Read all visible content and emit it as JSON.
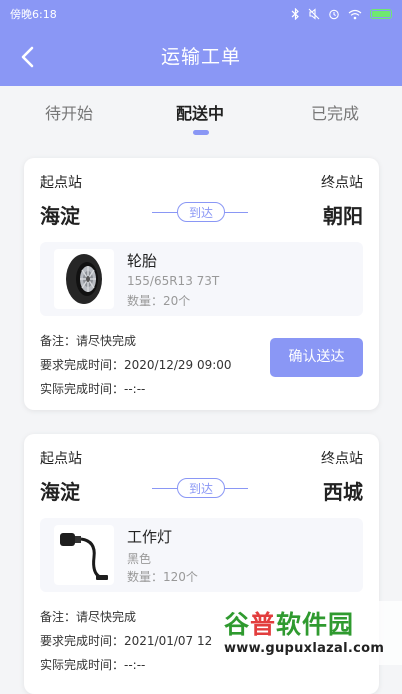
{
  "status_bar": {
    "time": "傍晚6:18",
    "icons": [
      "bluetooth-icon",
      "mute-icon",
      "alarm-icon",
      "wifi-icon",
      "battery-icon"
    ]
  },
  "header": {
    "title": "运输工单",
    "back_icon": "chevron-left-icon"
  },
  "tabs": [
    {
      "label": "待开始",
      "active": false
    },
    {
      "label": "配送中",
      "active": true
    },
    {
      "label": "已完成",
      "active": false
    }
  ],
  "orders": [
    {
      "start_label": "起点站",
      "start_name": "海淀",
      "end_label": "终点站",
      "end_name": "朝阳",
      "route_badge": "到达",
      "product": {
        "name": "轮胎",
        "spec": "155/65R13 73T",
        "qty": "数量：20个",
        "image_icon": "tire-icon"
      },
      "note": "备注：请尽快完成",
      "required_time": "要求完成时间：2020/12/29 09:00",
      "actual_time": "实际完成时间：--:--",
      "action_label": "确认送达"
    },
    {
      "start_label": "起点站",
      "start_name": "海淀",
      "end_label": "终点站",
      "end_name": "西城",
      "route_badge": "到达",
      "product": {
        "name": "工作灯",
        "spec": "黑色",
        "qty": "数量：120个",
        "image_icon": "work-lamp-icon"
      },
      "note": "备注：请尽快完成",
      "required_time": "要求完成时间：2021/01/07 12",
      "actual_time": "实际完成时间：--:--"
    }
  ],
  "watermark": {
    "part1": "谷",
    "part2": "普",
    "part3": "软件园",
    "url": "www.gupuxlazal.com"
  },
  "colors": {
    "accent": "#8a97f5",
    "background": "#f4f5f7"
  }
}
